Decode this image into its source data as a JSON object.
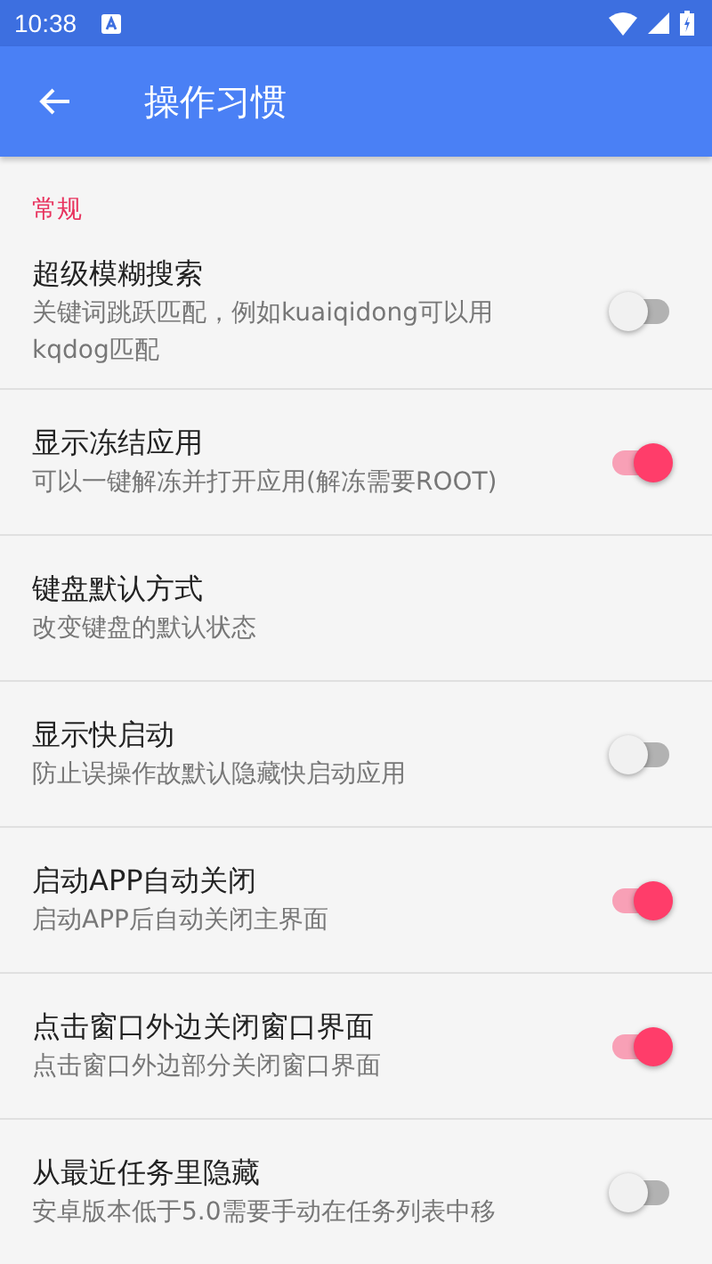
{
  "status_bar": {
    "time": "10:38"
  },
  "app_bar": {
    "title": "操作习惯"
  },
  "section": {
    "title": "常规"
  },
  "settings": [
    {
      "title": "超级模糊搜索",
      "summary": "关键词跳跃匹配，例如kuaiqidong可以用kqdog匹配",
      "kind": "switch",
      "on": false
    },
    {
      "title": "显示冻结应用",
      "summary": "可以一键解冻并打开应用(解冻需要ROOT)",
      "kind": "switch",
      "on": true
    },
    {
      "title": "键盘默认方式",
      "summary": "改变键盘的默认状态",
      "kind": "plain"
    },
    {
      "title": "显示快启动",
      "summary": "防止误操作故默认隐藏快启动应用",
      "kind": "switch",
      "on": false
    },
    {
      "title": "启动APP自动关闭",
      "summary": "启动APP后自动关闭主界面",
      "kind": "switch",
      "on": true
    },
    {
      "title": "点击窗口外边关闭窗口界面",
      "summary": "点击窗口外边部分关闭窗口界面",
      "kind": "switch",
      "on": true
    },
    {
      "title": "从最近任务里隐藏",
      "summary": "安卓版本低于5.0需要手动在任务列表中移",
      "kind": "switch",
      "on": false
    }
  ]
}
